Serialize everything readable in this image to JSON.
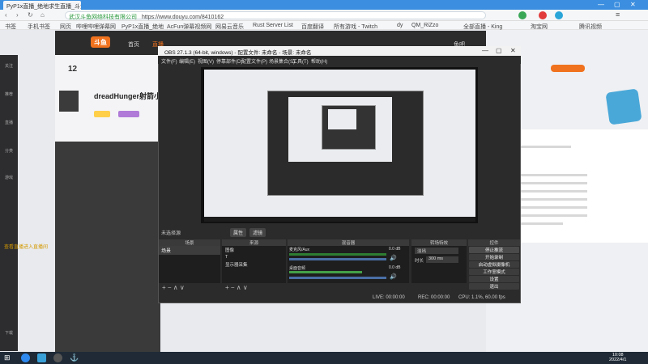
{
  "browser": {
    "tab_title": "PyP1x直播_绝地求生直播_斗鱼",
    "url_secure_label": "武汉斗鱼网络科技有限公司",
    "url": "https://www.douyu.com/8410162",
    "bookmarks": [
      "书签",
      "手机书签",
      "网页",
      "哔哩哔哩弹幕网",
      "PyP1x直播_绝地",
      "AcFun弹幕视频网",
      "网易云音乐",
      "Rust Server List",
      "百度翻译",
      "所有游戏 - Twitch",
      "dy",
      "QM_RiZzo",
      "全部直播 - King",
      "淘宝网",
      "腾讯视频"
    ]
  },
  "douyu": {
    "logo": "斗鱼",
    "nav": [
      "首页",
      "直播",
      "视频",
      "游戏",
      "鱼吧"
    ],
    "streamer_name": "dreadHunger射箭小子",
    "level": "12",
    "chat_link": "查看直播进入直播间",
    "left_nav": [
      "关注",
      "推荐",
      "直播",
      "分类",
      "游戏",
      "下载"
    ]
  },
  "obs": {
    "title": "OBS 27.1.3 (64-bit, windows) - 配置文件: 未命名 - 场景: 未命名",
    "menu": [
      "文件(F)",
      "编辑(E)",
      "视图(V)",
      "停靠部件(D)",
      "配置文件(P)",
      "场景集合(S)",
      "工具(T)",
      "帮助(H)"
    ],
    "no_source": "未选择源",
    "properties": "属性",
    "filters": "滤镜",
    "docks": {
      "scenes": "场景",
      "sources": "来源",
      "mixer": "混音器",
      "transitions": "转场特效",
      "controls": "控件"
    },
    "scene_item": "场景",
    "sources": [
      "图像",
      "T",
      "显示器采集"
    ],
    "mixer": [
      {
        "name": "麦克风/Aux",
        "db": "0.0 dB"
      },
      {
        "name": "桌面音频",
        "db": "0.0 dB"
      }
    ],
    "transition": {
      "type": "淡出",
      "duration_label": "时长",
      "duration": "300 ms"
    },
    "controls": [
      "停止推流",
      "开始录制",
      "启动虚拟摄像机",
      "工作室模式",
      "设置",
      "退出"
    ],
    "status": {
      "live": "LIVE: 00:00:00",
      "rec": "REC: 00:00:00",
      "cpu": "CPU: 1.1%, 60.00 fps"
    },
    "foot_icons": "+ − ∧ ∨"
  },
  "taskbar": {
    "time": "10:08",
    "date": "2022/4/1"
  }
}
